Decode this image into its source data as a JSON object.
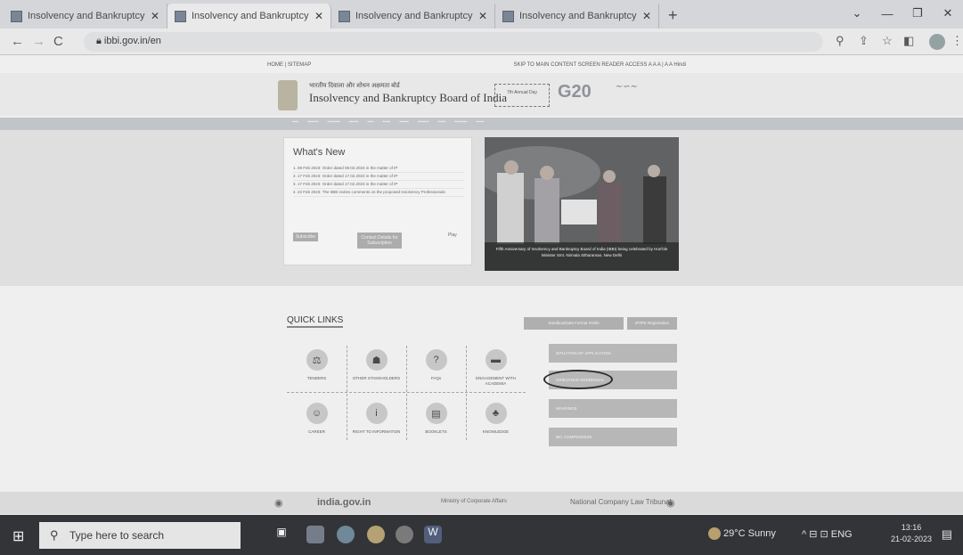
{
  "browser": {
    "tabs": [
      "Insolvency and Bankruptcy Boar",
      "Insolvency and Bankruptcy Boar",
      "Insolvency and Bankruptcy Boar",
      "Insolvency and Bankruptcy Boar"
    ],
    "new_tab": "+",
    "url": "ibbi.gov.in/en"
  },
  "site": {
    "top_left": "HOME | SITEMAP",
    "top_right": "SKIP TO MAIN CONTENT  SCREEN READER ACCESS  A  A  A  |  A  A  Hindi",
    "hindi_name": "भारतीय दिवाला और शोधन अक्षमता बोर्ड",
    "name": "Insolvency and Bankruptcy Board of India",
    "anniversary": "7th Annual Day",
    "g20": "G20"
  },
  "whats_new": {
    "title": "What's New",
    "items": [
      "1. 09 Feb 2023: Order dated 08.02.2023 in the matter of IP",
      "2. 17 Feb 2023: Order dated 17.02.2023 in the matter of IP",
      "3. 17 Feb 2023: Order dated 17.02.2023 in the matter of IP",
      "4. 22 Feb 2023: The IBBI invites comments on the proposed Insolvency Professionals"
    ],
    "subscribe": "Subscribe",
    "contact": "Contact Details for Subscription",
    "play": "Play"
  },
  "slide_caption": "Fifth Anniversary of Insolvency and Bankruptcy Board of India (IBBI) being celebrated by Hon'ble Minister Smt. Nirmala Sitharaman, New Delhi",
  "quick": {
    "title": "QUICK LINKS",
    "btn1": "Sandbox/Data Format Fields",
    "btn2": "IP/IPE Registration"
  },
  "grid": [
    "TENDERS",
    "OTHER STAKEHOLDERS",
    "FAQs",
    "ENGAGEMENT WITH ACADEMIA",
    "CAREER",
    "RIGHT TO INFORMATION",
    "BOOKLETS",
    "KNOWLEDGE"
  ],
  "right_list": [
    "SITUATION OF APPLICATION",
    "GRIEVANCE REDRESSAL",
    "HEARINGS",
    "IBC COMPENDIUM"
  ],
  "footer": {
    "india": "india.gov.in",
    "mca": "Ministry of Corporate Affairs",
    "nclt": "National Company Law Tribunal"
  },
  "taskbar": {
    "search": "Type here to search",
    "weather": "29°C  Sunny",
    "lang": "ENG",
    "time": "13:16",
    "date": "21-02-2023"
  }
}
